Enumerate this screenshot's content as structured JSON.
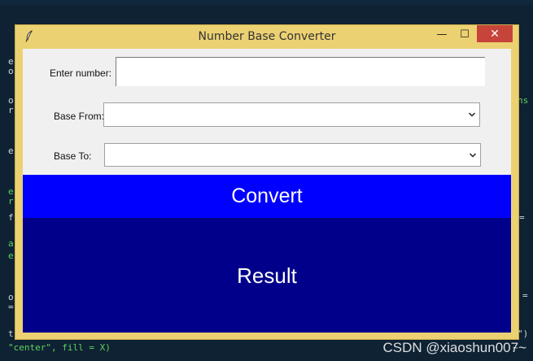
{
  "window": {
    "title": "Number Base Converter",
    "minimize_glyph": "—",
    "maximize_glyph": "☐",
    "close_glyph": "✕"
  },
  "form": {
    "number_label": "Enter number:",
    "number_value": "",
    "base_from_label": "Base From:",
    "base_from_value": "",
    "base_to_label": "Base To:",
    "base_to_value": ""
  },
  "convert_label": "Convert",
  "result_text": "Result",
  "terminal": {
    "left_chars": [
      "e",
      "o",
      "o",
      "r",
      "e",
      "e",
      "r",
      "f",
      "a",
      "e",
      "o",
      "="
    ],
    "right_chars": [
      "ns",
      "=",
      "=",
      "\")"
    ],
    "bottom_line_1": "t",
    "bottom_line_2": "\"center\", fill = X)",
    "bottom_right": "~"
  },
  "watermark": "CSDN @xiaoshun007~",
  "colors": {
    "convert_bg": "#0000fe",
    "result_bg": "#00008b",
    "window_frame": "#ecd172",
    "close_button": "#c7443a"
  },
  "icons": {
    "app": "feather-icon",
    "dropdown": "chevron-down-icon"
  }
}
